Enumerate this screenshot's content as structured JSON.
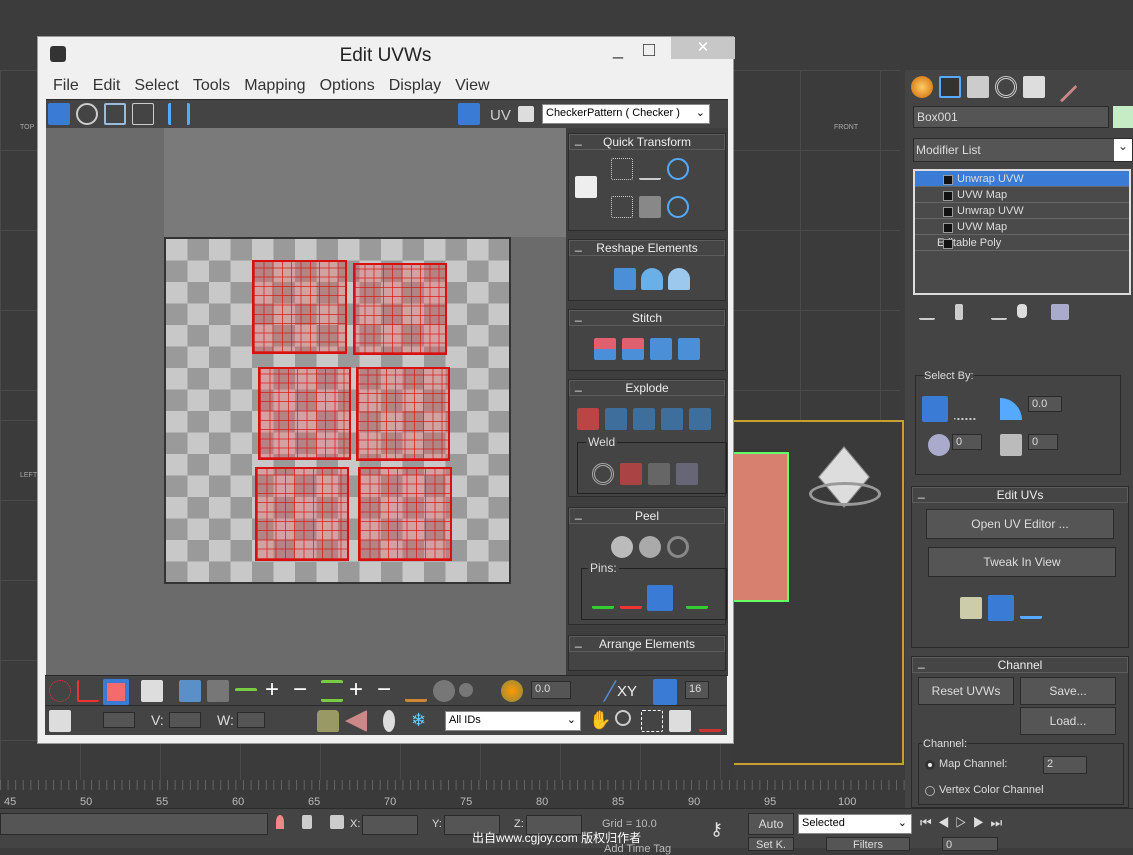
{
  "window": {
    "title": "Edit UVWs",
    "minimize": "_",
    "maximize": "□",
    "close": "✕"
  },
  "menu": [
    "File",
    "Edit",
    "Select",
    "Tools",
    "Mapping",
    "Options",
    "Display",
    "View"
  ],
  "toolbar": {
    "uv_label": "UV",
    "texture_dropdown": "CheckerPattern ( Checker )"
  },
  "rollouts": {
    "quick_transform": "Quick Transform",
    "reshape": "Reshape Elements",
    "stitch": "Stitch",
    "explode": "Explode",
    "weld": "Weld",
    "peel": "Peel",
    "pins": "Pins:",
    "arrange": "Arrange Elements"
  },
  "bottom_toolbar": {
    "soft_value": "0.0",
    "xy_label": "XY",
    "grid_value": "16",
    "u_label": "",
    "v_label": "V:",
    "w_label": "W:",
    "id_dropdown": "All IDs"
  },
  "viewport_labels": {
    "top": "TOP",
    "front": "FRONT",
    "left": "LEFT"
  },
  "command_panel": {
    "object_name": "Box001",
    "modifier_list": "Modifier List",
    "stack": [
      {
        "label": "Unwrap UVW",
        "selected": true
      },
      {
        "label": "UVW Map"
      },
      {
        "label": "Unwrap UVW"
      },
      {
        "label": "UVW Map"
      },
      {
        "label": "Editable Poly"
      }
    ],
    "select_by": "Select By:",
    "select_angle": "0.0",
    "select_v1": "0",
    "select_v2": "0",
    "edit_uvs": "Edit UVs",
    "open_uv_editor": "Open UV Editor ...",
    "tweak_in_view": "Tweak In View",
    "channel": "Channel",
    "reset_uvws": "Reset UVWs",
    "save": "Save...",
    "load": "Load...",
    "channel_label": "Channel:",
    "map_channel": "Map Channel:",
    "map_channel_value": "2",
    "vertex_color_channel": "Vertex Color Channel"
  },
  "timeline": {
    "ticks": [
      "45",
      "50",
      "55",
      "60",
      "65",
      "70",
      "75",
      "80",
      "85",
      "90",
      "95",
      "100"
    ]
  },
  "status": {
    "x_label": "X:",
    "y_label": "Y:",
    "z_label": "Z:",
    "grid": "Grid = 10.0",
    "auto": "Auto",
    "selected": "Selected",
    "setk": "Set K.",
    "filters": "Filters",
    "frame": "0",
    "add_time_tag": "Add Time Tag",
    "watermark": "出自www.cgjoy.com 版权归作者"
  },
  "colors": {
    "accent": "#3a7bd5",
    "island": "#d81010",
    "selected_row": "#3a7bd5"
  }
}
